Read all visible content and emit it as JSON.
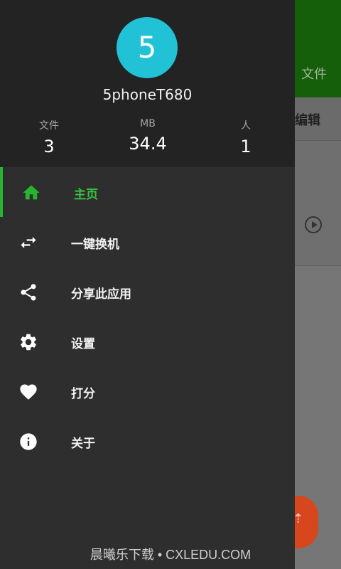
{
  "background": {
    "header_text": "文件",
    "toolbar_text": "编辑"
  },
  "drawer": {
    "avatar_letter": "5",
    "username": "5phoneT680",
    "stats": [
      {
        "label": "文件",
        "value": "3"
      },
      {
        "label": "MB",
        "value": "34.4"
      },
      {
        "label": "人",
        "value": "1"
      }
    ],
    "menu": [
      {
        "label": "主页",
        "icon": "home-icon",
        "active": true
      },
      {
        "label": "一键换机",
        "icon": "swap-icon",
        "active": false
      },
      {
        "label": "分享此应用",
        "icon": "share-icon",
        "active": false
      },
      {
        "label": "设置",
        "icon": "gear-icon",
        "active": false
      },
      {
        "label": "打分",
        "icon": "heart-icon",
        "active": false
      },
      {
        "label": "关于",
        "icon": "info-icon",
        "active": false
      }
    ]
  },
  "watermark": "晨曦乐下载 • CXLEDU.COM",
  "colors": {
    "accent_green": "#27b52f",
    "avatar_cyan": "#22c2d6",
    "fab_orange": "#d8461e",
    "drawer_bg": "#2e2e2e",
    "header_bg": "#232323"
  }
}
